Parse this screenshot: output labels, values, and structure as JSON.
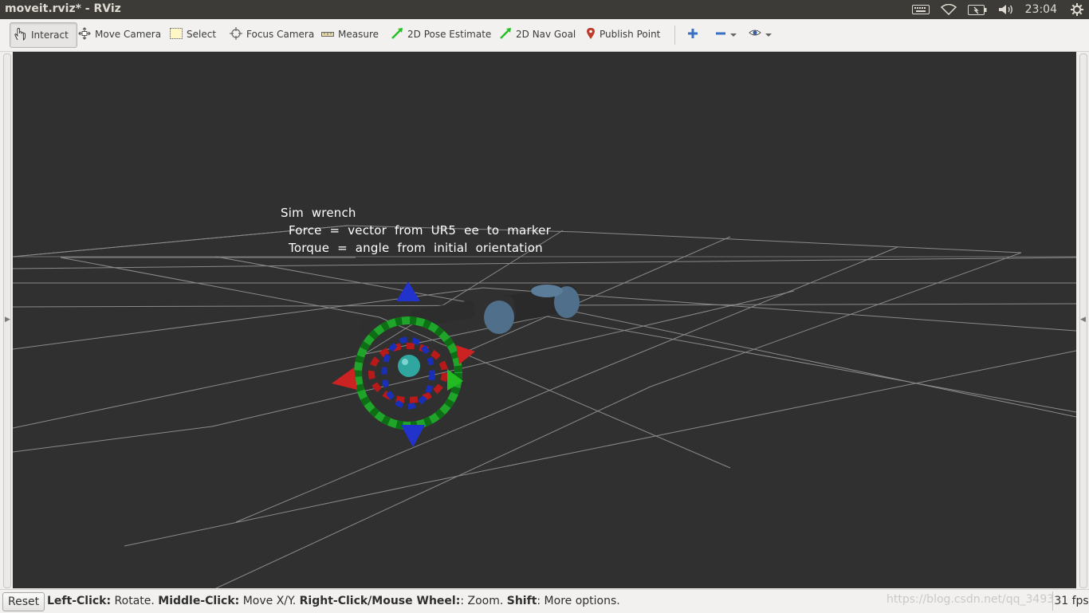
{
  "window": {
    "title": "moveit.rviz* - RViz"
  },
  "system_tray": {
    "icons": [
      "keyboard-icon",
      "wifi-icon",
      "battery-icon",
      "volume-icon",
      "settings-gear-icon"
    ],
    "clock": "23:04"
  },
  "toolbar": {
    "tools": [
      {
        "label": "Interact",
        "icon": "hand-pointer-icon",
        "active": true
      },
      {
        "label": "Move Camera",
        "icon": "move-camera-icon",
        "active": false
      },
      {
        "label": "Select",
        "icon": "select-box-icon",
        "active": false
      },
      {
        "label": "Focus Camera",
        "icon": "focus-crosshair-icon",
        "active": false
      },
      {
        "label": "Measure",
        "icon": "ruler-icon",
        "active": false
      },
      {
        "label": "2D Pose Estimate",
        "icon": "green-arrow-icon",
        "active": false
      },
      {
        "label": "2D Nav Goal",
        "icon": "green-arrow-icon",
        "active": false
      },
      {
        "label": "Publish Point",
        "icon": "map-pin-icon",
        "active": false
      }
    ],
    "extra_icons": [
      "add-tool-icon",
      "remove-tool-icon",
      "view-eye-icon"
    ],
    "colors": {
      "accent_green": "#22c022",
      "pin_red": "#c0392b",
      "plus_blue": "#3a6fc4"
    }
  },
  "viewport": {
    "background": "#303030",
    "overlay_text": {
      "line1": "Sim  wrench",
      "line2": "Force  =  vector  from  UR5  ee  to  marker",
      "line3": "Torque  =  angle  from  initial  orientation"
    }
  },
  "statusbar": {
    "reset_label": "Reset",
    "hint_parts": [
      {
        "bold": "Left-Click:",
        "text": " Rotate. "
      },
      {
        "bold": "Middle-Click:",
        "text": " Move X/Y. "
      },
      {
        "bold": "Right-Click/Mouse Wheel:",
        "text": ": Zoom. "
      },
      {
        "bold": "Shift",
        "text": ": More options."
      }
    ],
    "watermark": "https://blog.csdn.net/qq_3493",
    "fps": "31 fps"
  }
}
